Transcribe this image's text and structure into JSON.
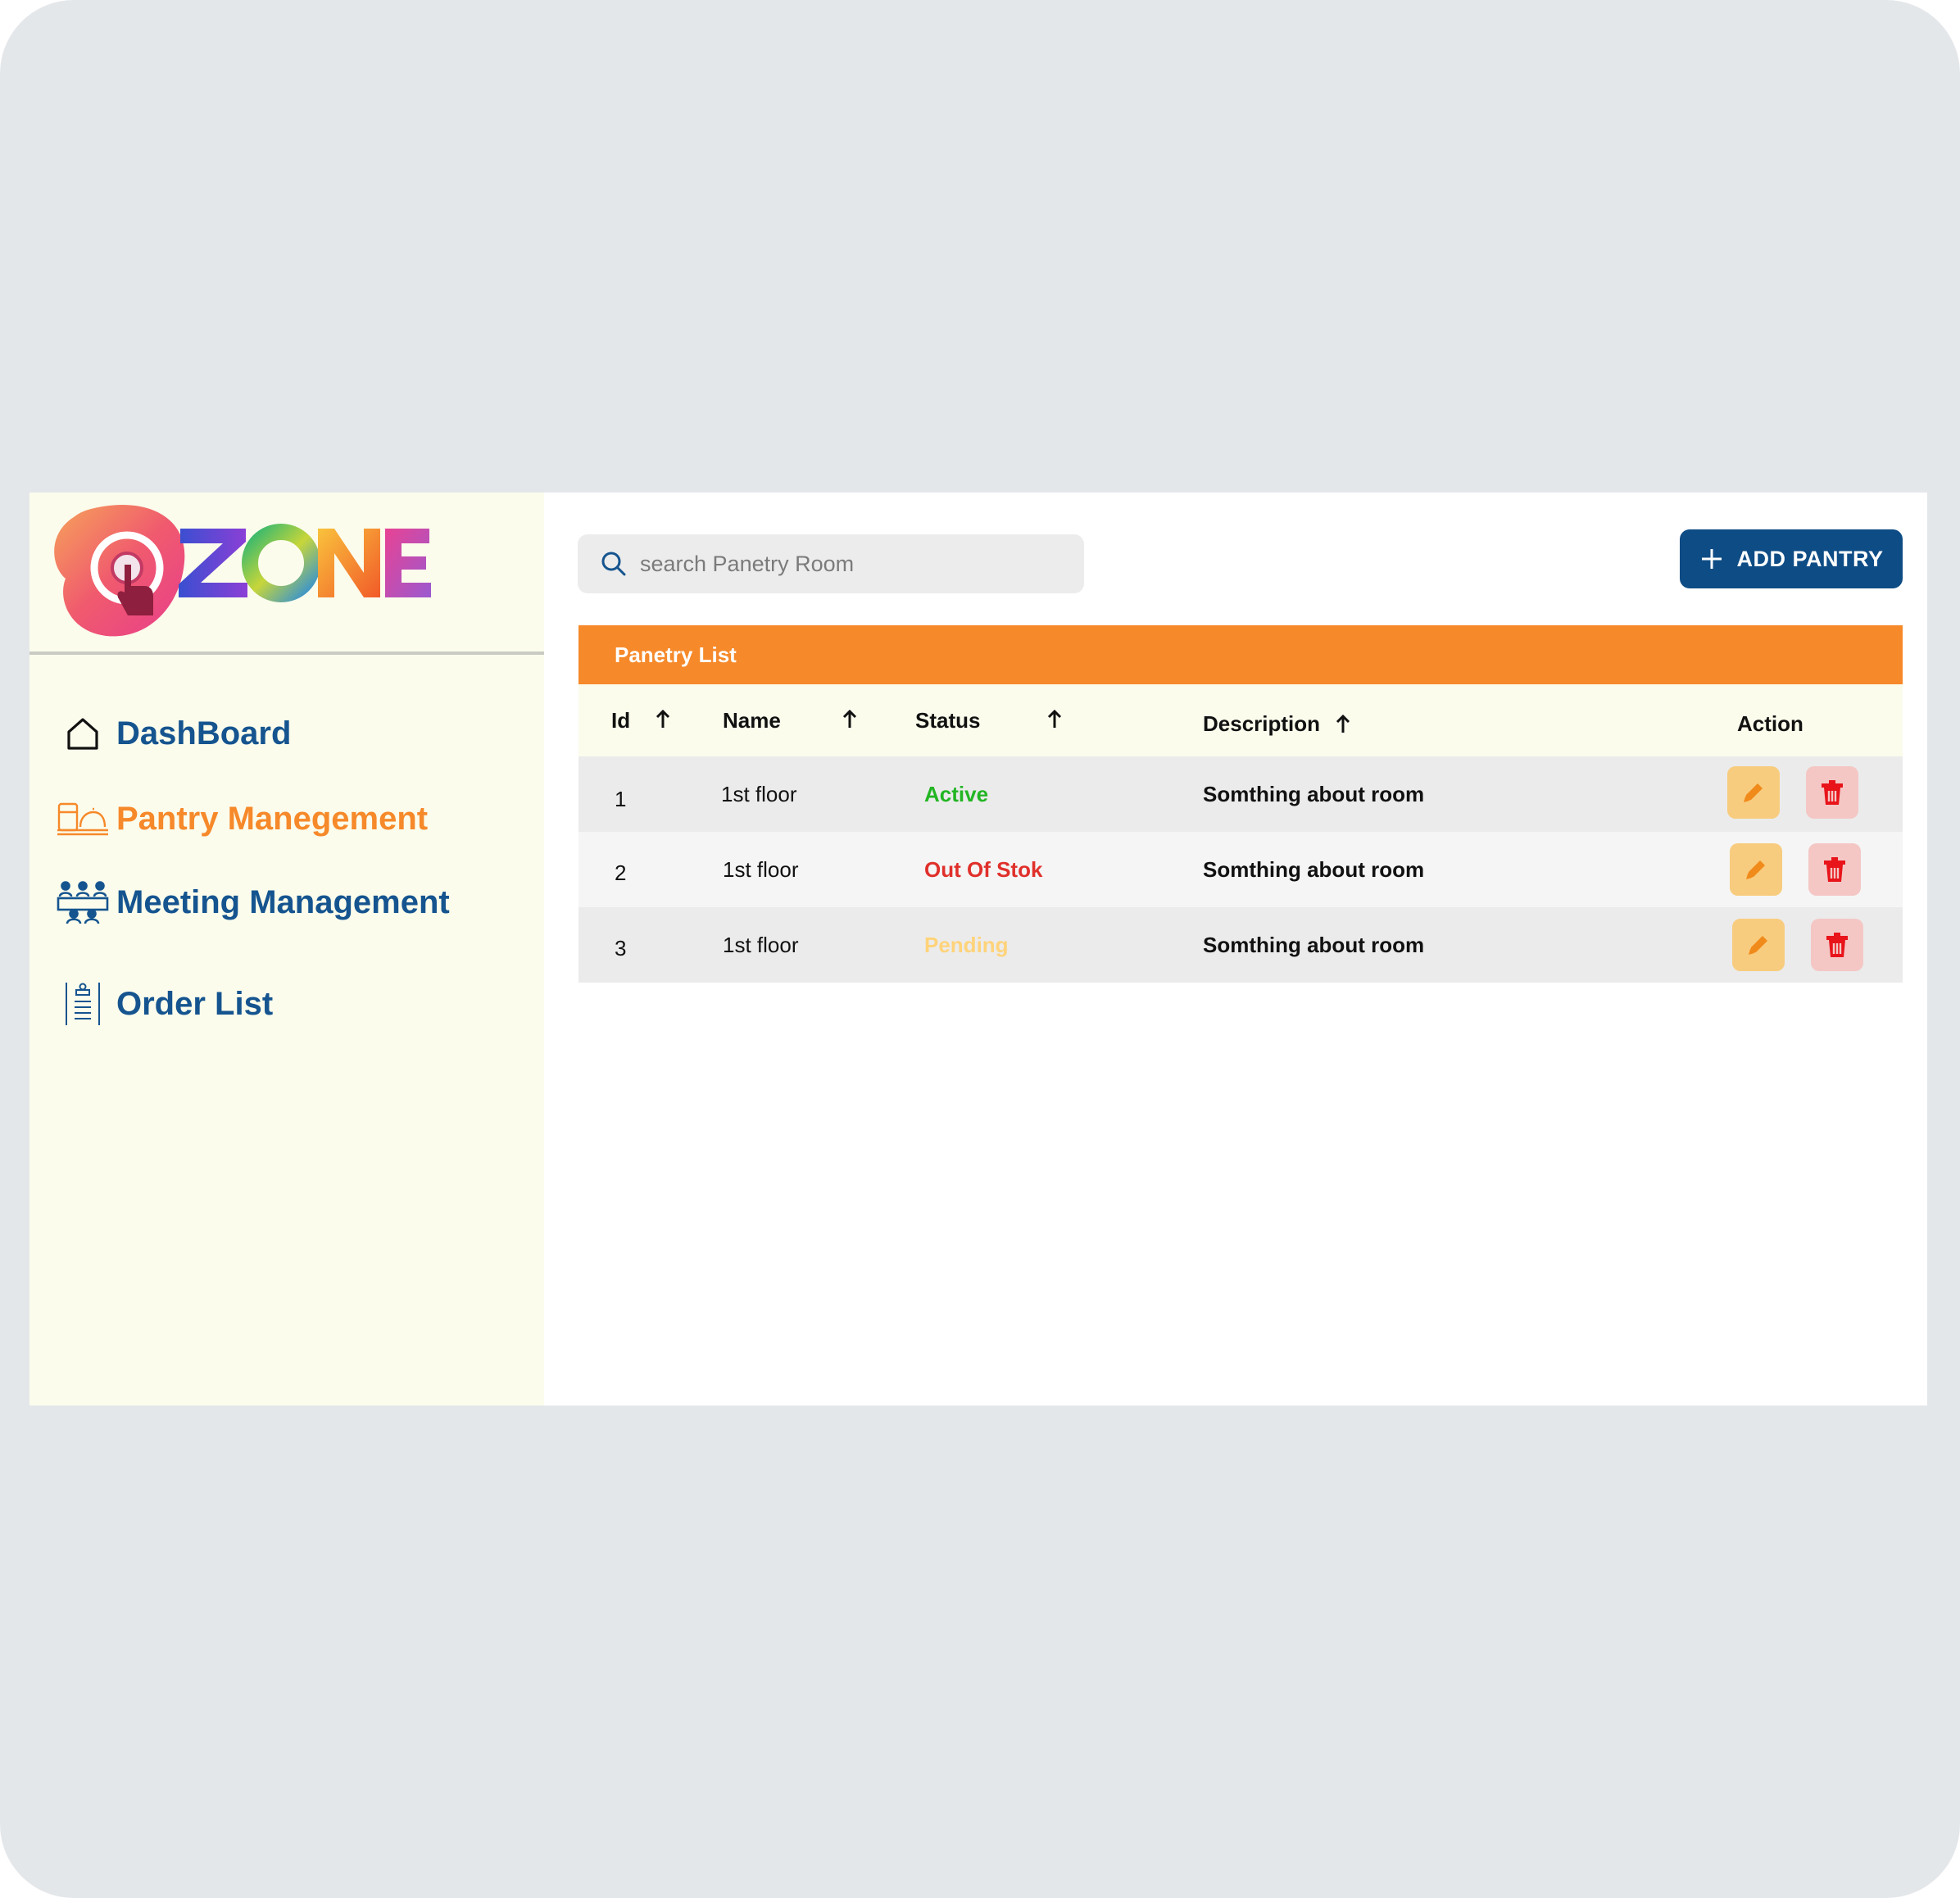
{
  "brand": {
    "logo_text": "OZONE"
  },
  "sidebar": {
    "items": [
      {
        "label": "DashBoard",
        "icon": "home-icon",
        "active": false
      },
      {
        "label": "Pantry Manegement",
        "icon": "pantry-icon",
        "active": true
      },
      {
        "label": "Meeting Management",
        "icon": "meeting-icon",
        "active": false
      },
      {
        "label": "Order List",
        "icon": "order-list-icon",
        "active": false
      }
    ]
  },
  "search": {
    "placeholder": "search Panetry Room",
    "value": ""
  },
  "toolbar": {
    "add_label": "ADD PANTRY"
  },
  "table": {
    "title": "Panetry List",
    "columns": [
      "Id",
      "Name",
      "Status",
      "Description",
      "Action"
    ],
    "rows": [
      {
        "id": "1",
        "name": "1st floor",
        "status": "Active",
        "description": "Somthing about room"
      },
      {
        "id": "2",
        "name": "1st floor",
        "status": "Out Of Stok",
        "description": "Somthing about room"
      },
      {
        "id": "3",
        "name": "1st floor",
        "status": "Pending",
        "description": "Somthing about room"
      }
    ]
  },
  "colors": {
    "accent": "#f6892a",
    "primary": "#0e4c85",
    "nav_text": "#15548f",
    "status_active": "#22b523",
    "status_out_of_stock": "#e0302b",
    "status_pending": "#ffd37a",
    "delete_icon": "#e8141a",
    "edit_icon": "#f08a1a"
  }
}
